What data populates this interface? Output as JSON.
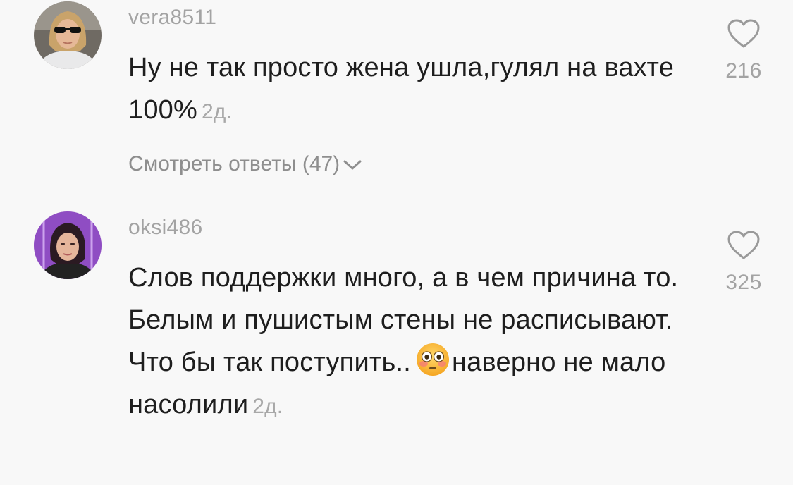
{
  "comments": [
    {
      "username": "vera8511",
      "text": "Ну не так просто жена ушла,гулял на вахте 100%",
      "age": "2д.",
      "likes": "216",
      "view_replies": "Смотреть ответы (47)",
      "avatar_icon": "avatar-woman-sunglasses"
    },
    {
      "username": "oksi486",
      "text_before_emoji": "Слов поддержки много, а в чем причина то. Белым и пушистым стены не расписывают. Что бы так поступить..",
      "emoji": "flushed-face-emoji",
      "text_after_emoji": "наверно не мало насолили",
      "age": "2д.",
      "likes": "325",
      "avatar_icon": "avatar-woman-purple-lights"
    }
  ],
  "colors": {
    "background": "#f8f8f8",
    "text": "#1e1e1e",
    "muted": "#a3a3a3",
    "heart_stroke": "#9a9a9a"
  }
}
